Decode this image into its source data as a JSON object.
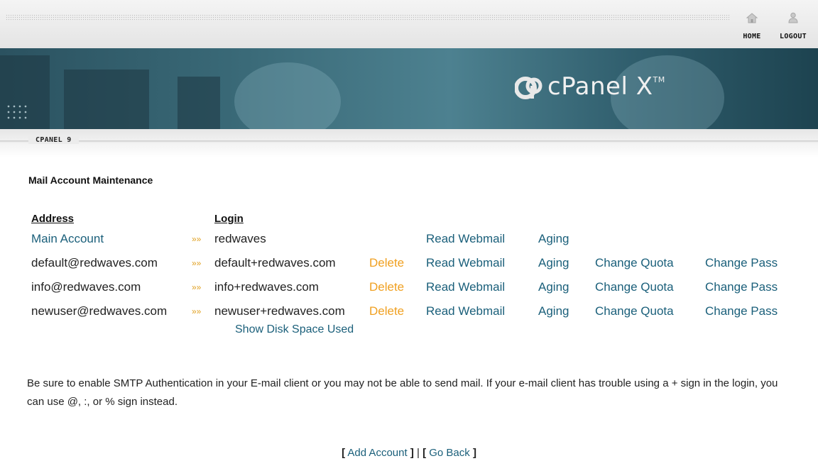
{
  "topbar": {
    "home_label": "HOME",
    "logout_label": "LOGOUT"
  },
  "banner": {
    "logo_text": "cPanel",
    "logo_x": "X",
    "logo_tm": "TM"
  },
  "breadcrumb": {
    "label": "CPANEL 9"
  },
  "page": {
    "title": "Mail Account Maintenance"
  },
  "table": {
    "headers": {
      "address": "Address",
      "login": "Login"
    },
    "arrow_glyph": "»»",
    "rows": [
      {
        "address": "Main Account",
        "login": "redwaves",
        "delete": "",
        "read_webmail": "Read Webmail",
        "aging": "Aging",
        "change_quota": "",
        "change_pass": ""
      },
      {
        "address": "default@redwaves.com",
        "login": "default+redwaves.com",
        "delete": "Delete",
        "read_webmail": "Read Webmail",
        "aging": "Aging",
        "change_quota": "Change Quota",
        "change_pass": "Change Pass"
      },
      {
        "address": "info@redwaves.com",
        "login": "info+redwaves.com",
        "delete": "Delete",
        "read_webmail": "Read Webmail",
        "aging": "Aging",
        "change_quota": "Change Quota",
        "change_pass": "Change Pass"
      },
      {
        "address": "newuser@redwaves.com",
        "login": "newuser+redwaves.com",
        "delete": "Delete",
        "read_webmail": "Read Webmail",
        "aging": "Aging",
        "change_quota": "Change Quota",
        "change_pass": "Change Pass"
      }
    ],
    "show_disk_space": "Show Disk Space Used"
  },
  "note": "Be sure to enable SMTP Authentication in your E-mail client or you may not be able to send mail. If your e-mail client has trouble using a + sign in the login, you can use @, :, or % sign instead.",
  "footer": {
    "add_account": "Add Account",
    "go_back": "Go Back",
    "separator": "|",
    "bracket_open": "[",
    "bracket_close": "]"
  },
  "colors": {
    "link": "#1a5f7a",
    "delete": "#f0a020",
    "banner": "#2b5260"
  },
  "icons": {
    "home": "home-icon",
    "logout": "user-logout-icon"
  }
}
